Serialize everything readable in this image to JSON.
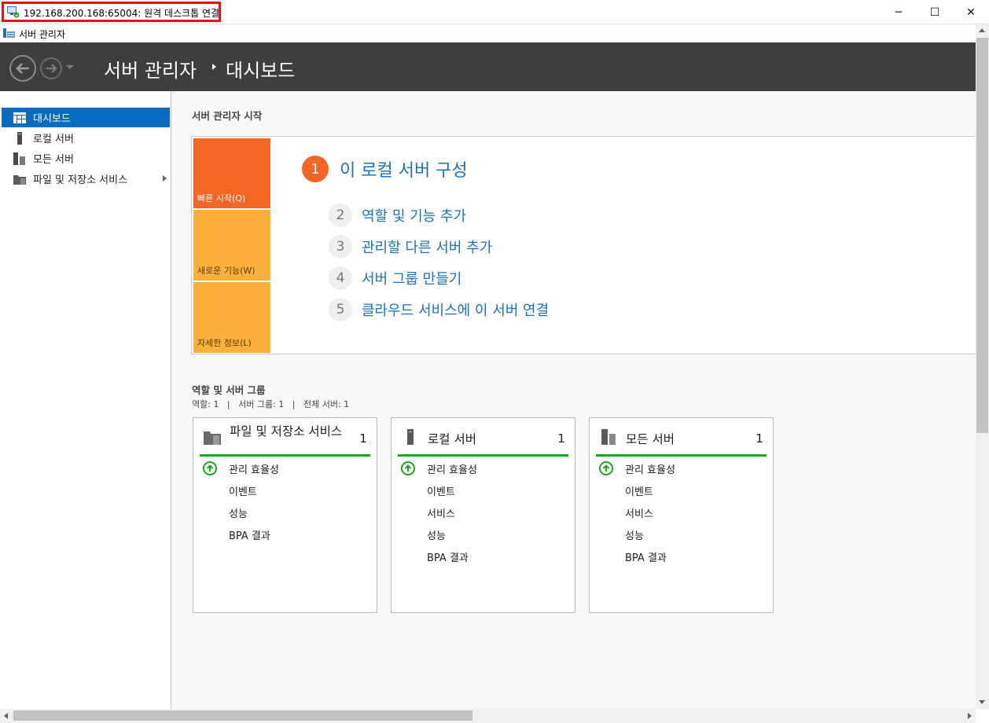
{
  "window": {
    "title": "192.168.200.168:65004: 원격 데스크톱 연결",
    "minimize_glyph": "─",
    "maximize_glyph": "☐",
    "close_glyph": "✕"
  },
  "app": {
    "title": "서버 관리자"
  },
  "header": {
    "breadcrumb_root": "서버 관리자",
    "breadcrumb_current": "대시보드"
  },
  "sidebar": {
    "items": [
      {
        "label": "대시보드",
        "icon": "dashboard-icon"
      },
      {
        "label": "로컬 서버",
        "icon": "server-icon"
      },
      {
        "label": "모든 서버",
        "icon": "servers-icon"
      },
      {
        "label": "파일 및 저장소 서비스",
        "icon": "file-storage-icon"
      }
    ]
  },
  "welcome": {
    "title": "서버 관리자 시작",
    "tabs": [
      "빠른 시작(Q)",
      "새로운 기능(W)",
      "자세한 정보(L)"
    ],
    "main_step": {
      "num": "1",
      "label": "이 로컬 서버 구성"
    },
    "steps": [
      {
        "num": "2",
        "label": "역할 및 기능 추가"
      },
      {
        "num": "3",
        "label": "관리할 다른 서버 추가"
      },
      {
        "num": "4",
        "label": "서버 그룹 만들기"
      },
      {
        "num": "5",
        "label": "클라우드 서비스에 이 서버 연결"
      }
    ]
  },
  "roles": {
    "title": "역할 및 서버 그룹",
    "summary": "역할: 1   |   서버 그룹: 1   |   전체 서버: 1",
    "tiles": [
      {
        "title": "파일 및 저장소 서비스",
        "count": "1",
        "rows": [
          "관리 효율성",
          "이벤트",
          "성능",
          "BPA 결과"
        ]
      },
      {
        "title": "로컬 서버",
        "count": "1",
        "rows": [
          "관리 효율성",
          "이벤트",
          "서비스",
          "성능",
          "BPA 결과"
        ]
      },
      {
        "title": "모든 서버",
        "count": "1",
        "rows": [
          "관리 효율성",
          "이벤트",
          "서비스",
          "성능",
          "BPA 결과"
        ]
      }
    ]
  },
  "colors": {
    "header_bg": "#3e3e3e",
    "active_nav": "#0a6cc0",
    "quick_start": "#f26522",
    "tab_inactive": "#fbb03b",
    "link": "#1a73b8",
    "status_ok": "#1aa81a",
    "highlight_box": "#e8101c"
  }
}
